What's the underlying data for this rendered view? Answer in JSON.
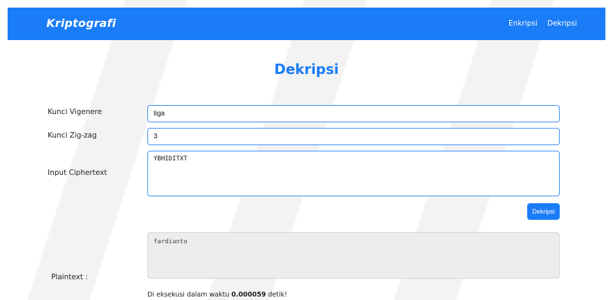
{
  "navbar": {
    "brand": "Kriptografi",
    "links": [
      "Enkripsi",
      "Dekripsi"
    ]
  },
  "page": {
    "title": "Dekripsi"
  },
  "form": {
    "vigenere_label": "Kunci Vigenere",
    "vigenere_value": "tiga",
    "zigzag_label": "Kunci Zig-zag",
    "zigzag_value": "3",
    "ciphertext_label": "Input Ciphertext",
    "ciphertext_value": "YBHIDITXT",
    "submit_label": "Dekripsi"
  },
  "result": {
    "plaintext_label": "Plaintext :",
    "plaintext_value": "fardianto",
    "exec_prefix": "Di eksekusi dalam waktu",
    "exec_time": "0.000059",
    "exec_suffix": "detik!"
  },
  "colors": {
    "accent": "#1a7cf7"
  }
}
